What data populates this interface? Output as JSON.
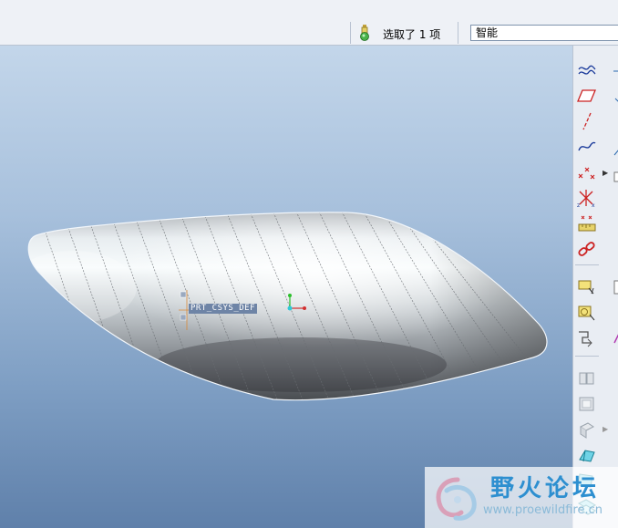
{
  "status": {
    "selection_text": "选取了 1 项",
    "filter_value": "智能"
  },
  "viewport": {
    "csys_label": "PRT_CSYS_DEF"
  },
  "toolbar": {
    "items": [
      {
        "name": "sketch-tool",
        "icon": "sketch-curve-icon"
      },
      {
        "name": "plane-tool",
        "icon": "datum-plane-icon"
      },
      {
        "name": "axis-tool",
        "icon": "datum-axis-icon"
      },
      {
        "name": "curve-tool",
        "icon": "datum-curve-icon"
      },
      {
        "name": "point-tool",
        "icon": "datum-point-icon"
      },
      {
        "name": "csys-tool",
        "icon": "coordinate-system-icon"
      },
      {
        "name": "analysis-tool",
        "icon": "analysis-icon"
      },
      {
        "name": "chain-tool",
        "icon": "chain-link-icon"
      },
      {
        "name": "extrude-tool",
        "icon": "extrude-icon"
      },
      {
        "name": "revolve-tool",
        "icon": "revolve-icon"
      },
      {
        "name": "sweep-tool",
        "icon": "sweep-icon"
      },
      {
        "name": "pattern-tool",
        "icon": "pattern-icon"
      },
      {
        "name": "shell-tool",
        "icon": "shell-icon"
      },
      {
        "name": "draft-tool",
        "icon": "draft-icon"
      },
      {
        "name": "style-tool",
        "icon": "style-surface-icon"
      },
      {
        "name": "boundary-tool",
        "icon": "boundary-blend-icon"
      }
    ]
  },
  "watermark": {
    "title": "野火论坛",
    "url": "www.proewildfire.cn"
  }
}
